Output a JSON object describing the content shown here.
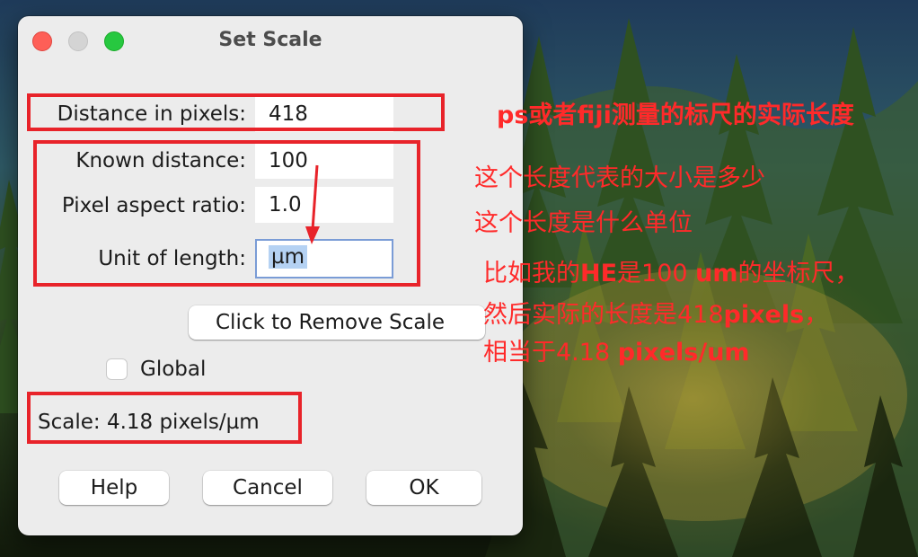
{
  "window": {
    "title": "Set Scale"
  },
  "fields": {
    "distance_label": "Distance in pixels:",
    "distance_value": "418",
    "known_label": "Known distance:",
    "known_value": "100",
    "aspect_label": "Pixel aspect ratio:",
    "aspect_value": "1.0",
    "unit_label": "Unit of length:",
    "unit_value": "µm"
  },
  "buttons": {
    "remove_scale": "Click to Remove Scale",
    "help": "Help",
    "cancel": "Cancel",
    "ok": "OK"
  },
  "global_label": "Global",
  "scale_text": "Scale: 4.18 pixels/µm",
  "annotations": {
    "line1": "ps或者fiji测量的标尺的实际长度",
    "line2": "这个长度代表的大小是多少",
    "line3": "这个长度是什么单位",
    "line4_a": "比如我的",
    "line4_b": "HE",
    "line4_c": "是100 ",
    "line4_d": "um",
    "line4_e": "的坐标尺，",
    "line5_a": "然后实际的长度是418",
    "line5_b": "pixels",
    "line5_c": "，",
    "line6_a": "相当于4.18 ",
    "line6_b": "pixels/um"
  },
  "colors": {
    "annotation_red": "#e8232a",
    "close": "#fe5f57",
    "zoom": "#27c840",
    "selection": "#b5d2f3"
  },
  "icons": {
    "close": "red-circle",
    "minimize": "gray-circle",
    "zoom": "green-circle"
  }
}
